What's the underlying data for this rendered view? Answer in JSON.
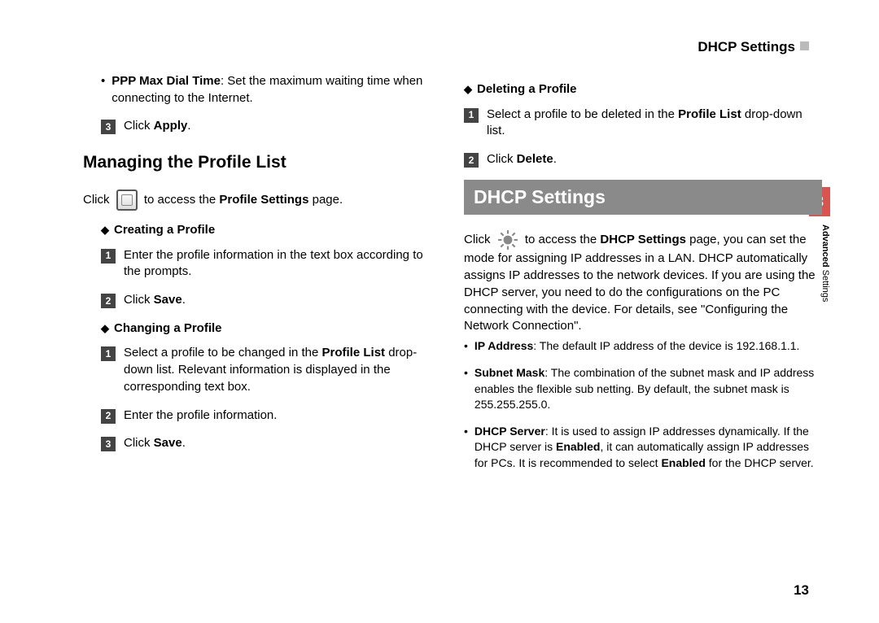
{
  "header": {
    "title": "DHCP Settings"
  },
  "sideTab": {
    "num": "3",
    "label_bold": "Advanced",
    "label_rest": " Settings"
  },
  "pageNumber": "13",
  "left": {
    "ppp_bold": "PPP Max Dial Time",
    "ppp_rest": ": Set the maximum waiting time when connecting to the Internet.",
    "step3_a": "Click ",
    "step3_b": "Apply",
    "step3_c": ".",
    "managing_head": "Managing the Profile List",
    "click_a": "Click",
    "click_b": " to access the ",
    "click_c": "Profile Settings",
    "click_d": " page.",
    "creating_head": "Creating a Profile",
    "c_step1": "Enter the profile information in the text box according to the prompts.",
    "c_step2_a": "Click ",
    "c_step2_b": "Save",
    "c_step2_c": ".",
    "changing_head": "Changing a Profile",
    "ch_step1_a": "Select a profile to be changed in the ",
    "ch_step1_b": "Profile List",
    "ch_step1_c": " drop-down list. Relevant information is displayed in the corresponding text box.",
    "ch_step2": "Enter the profile information.",
    "ch_step3_a": "Click ",
    "ch_step3_b": "Save",
    "ch_step3_c": "."
  },
  "right": {
    "deleting_head": "Deleting a Profile",
    "d_step1_a": "Select a profile to be deleted in the ",
    "d_step1_b": "Profile List",
    "d_step1_c": " drop-down list.",
    "d_step2_a": "Click ",
    "d_step2_b": "Delete",
    "d_step2_c": ".",
    "banner": "DHCP Settings",
    "dhcp_click_a": "Click",
    "dhcp_click_b": " to access the ",
    "dhcp_click_c": "DHCP Settings",
    "dhcp_click_d": " page, you can set the mode for assigning IP addresses in a LAN. DHCP automatically assigns IP addresses to the network devices. If you are using the DHCP server, you need to do the configurations on the PC connecting with the device. For details, see \"Configuring the Network Connection\".",
    "ip_b": "IP Address",
    "ip_r": ": The default IP address of the device is 192.168.1.1.",
    "subnet_b": "Subnet Mask",
    "subnet_r": ": The combination of the subnet mask and IP address enables the flexible sub netting. By default, the subnet mask is 255.255.255.0.",
    "dhcp_b": "DHCP Server",
    "dhcp_r1": ": It is used to assign IP addresses dynamically. If the DHCP server is ",
    "dhcp_en": "Enabled",
    "dhcp_r2": ", it can automatically assign IP addresses for PCs. It is recommended to select ",
    "dhcp_r3": " for the DHCP server."
  },
  "nums": {
    "n1": "1",
    "n2": "2",
    "n3": "3"
  }
}
